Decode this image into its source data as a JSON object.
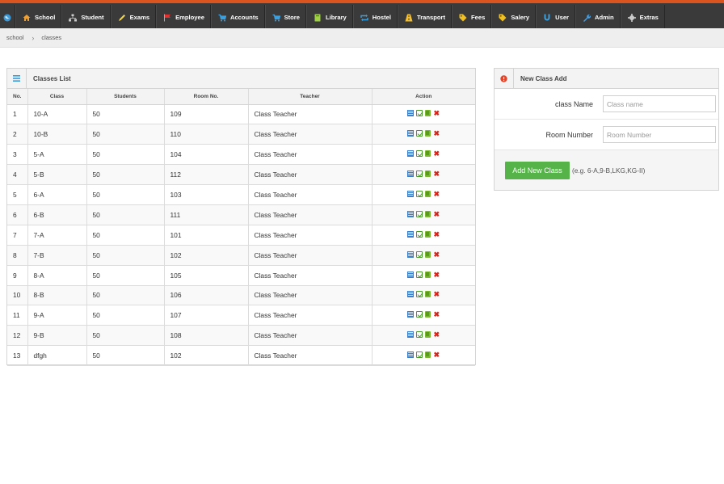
{
  "nav": {
    "items": [
      {
        "label": "School",
        "icon": "home-icon",
        "color": "#f0a030"
      },
      {
        "label": "Student",
        "icon": "sitemap-icon",
        "color": "#cccccc"
      },
      {
        "label": "Exams",
        "icon": "pencil-icon",
        "color": "#f5d43a"
      },
      {
        "label": "Employee",
        "icon": "flag-icon",
        "color": "#e03030"
      },
      {
        "label": "Accounts",
        "icon": "cart-icon",
        "color": "#3aa0e0"
      },
      {
        "label": "Store",
        "icon": "cart-icon",
        "color": "#3aa0e0"
      },
      {
        "label": "Library",
        "icon": "book-icon",
        "color": "#9fd045"
      },
      {
        "label": "Hostel",
        "icon": "loop-icon",
        "color": "#3aa0e0"
      },
      {
        "label": "Transport",
        "icon": "road-icon",
        "color": "#f5c030"
      },
      {
        "label": "Fees",
        "icon": "tag-icon",
        "color": "#f0c020"
      },
      {
        "label": "Salery",
        "icon": "tag-icon",
        "color": "#f0c020"
      },
      {
        "label": "User",
        "icon": "magnet-icon",
        "color": "#3aa0e0"
      },
      {
        "label": "Admin",
        "icon": "wrench-icon",
        "color": "#4aa0e0"
      },
      {
        "label": "Extras",
        "icon": "gear-icon",
        "color": "#cccccc"
      }
    ]
  },
  "breadcrumb": {
    "root": "school",
    "current": "classes"
  },
  "classes": {
    "title": "Classes List",
    "columns": [
      "No.",
      "Class",
      "Students",
      "Room No.",
      "Teacher",
      "Action"
    ],
    "rows": [
      [
        "1",
        "10-A",
        "50",
        "109",
        "Class Teacher"
      ],
      [
        "2",
        "10-B",
        "50",
        "110",
        "Class Teacher"
      ],
      [
        "3",
        "5-A",
        "50",
        "104",
        "Class Teacher"
      ],
      [
        "4",
        "5-B",
        "50",
        "112",
        "Class Teacher"
      ],
      [
        "5",
        "6-A",
        "50",
        "103",
        "Class Teacher"
      ],
      [
        "6",
        "6-B",
        "50",
        "111",
        "Class Teacher"
      ],
      [
        "7",
        "7-A",
        "50",
        "101",
        "Class Teacher"
      ],
      [
        "8",
        "7-B",
        "50",
        "102",
        "Class Teacher"
      ],
      [
        "9",
        "8-A",
        "50",
        "105",
        "Class Teacher"
      ],
      [
        "10",
        "8-B",
        "50",
        "106",
        "Class Teacher"
      ],
      [
        "11",
        "9-A",
        "50",
        "107",
        "Class Teacher"
      ],
      [
        "12",
        "9-B",
        "50",
        "108",
        "Class Teacher"
      ],
      [
        "13",
        "dfgh",
        "50",
        "102",
        "Class Teacher"
      ]
    ]
  },
  "add_form": {
    "title": "New Class Add",
    "class_name_label": "class Name",
    "class_name_placeholder": "Class name",
    "class_name_value": "",
    "room_label": "Room Number",
    "room_placeholder": "Room Number",
    "room_value": "",
    "submit_label": "Add New Class",
    "hint": "(e.g. 6-A,9-B,LKG,KG-II)"
  }
}
